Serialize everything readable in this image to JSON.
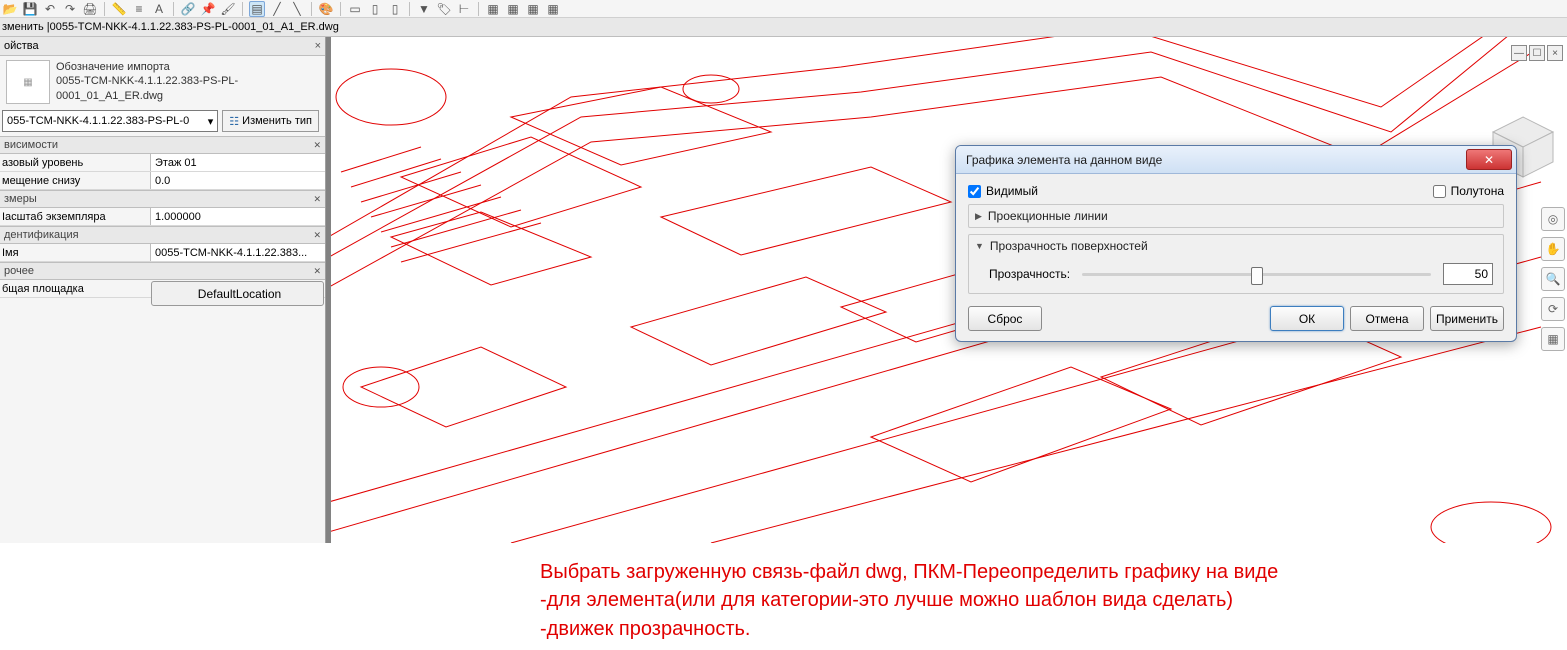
{
  "toolbar": {
    "icons": [
      "open",
      "save",
      "undo",
      "redo",
      "print",
      "measure",
      "sep",
      "align",
      "text",
      "sep",
      "link",
      "pin",
      "sep",
      "highlight",
      "line",
      "line2",
      "line3",
      "sep",
      "paint",
      "sep",
      "select",
      "wall",
      "wall2",
      "sep",
      "filter",
      "tag",
      "tag2",
      "dim",
      "dim2",
      "sep",
      "schedule",
      "sheet",
      "sheet2",
      "sheet3"
    ]
  },
  "title": {
    "prefix": "зменить | ",
    "file": "0055-TCM-NKK-4.1.1.22.383-PS-PL-0001_01_A1_ER.dwg"
  },
  "panel": {
    "title": "ойства",
    "import_label": "Обозначение импорта",
    "import_file": "0055-TCM-NKK-4.1.1.22.383-PS-PL-0001_01_A1_ER.dwg",
    "type_value": "055-TCM-NKK-4.1.1.22.383-PS-PL-0",
    "edit_type": "Изменить тип",
    "cats": {
      "deps": {
        "label": "висимости",
        "rows": [
          {
            "k": "азовый уровень",
            "v": "Этаж 01"
          },
          {
            "k": "мещение снизу",
            "v": "0.0"
          }
        ]
      },
      "dims": {
        "label": "змеры",
        "rows": [
          {
            "k": "Іасштаб экземпляра",
            "v": "1.000000"
          }
        ]
      },
      "ident": {
        "label": "дентификация",
        "rows": [
          {
            "k": "Імя",
            "v": "0055-TCM-NKK-4.1.1.22.383..."
          }
        ]
      },
      "other": {
        "label": "рочее",
        "rows": [
          {
            "k": "бщая площадка",
            "v": "DefaultLocation",
            "btn": true
          }
        ]
      }
    }
  },
  "dialog": {
    "title": "Графика элемента на данном виде",
    "visible": "Видимый",
    "halftone": "Полутона",
    "g1": "Проекционные линии",
    "g2": "Прозрачность поверхностей",
    "transp_label": "Прозрачность:",
    "transp_value": "50",
    "reset": "Сброс",
    "ok": "ОК",
    "cancel": "Отмена",
    "apply": "Применить"
  },
  "annotation": {
    "line1": "Выбрать загруженную связь-файл dwg, ПКМ-Переопределить графику на виде",
    "line2": "-для элемента(или для категории-это лучше можно шаблон вида сделать)",
    "line3": "-движек прозрачность."
  }
}
